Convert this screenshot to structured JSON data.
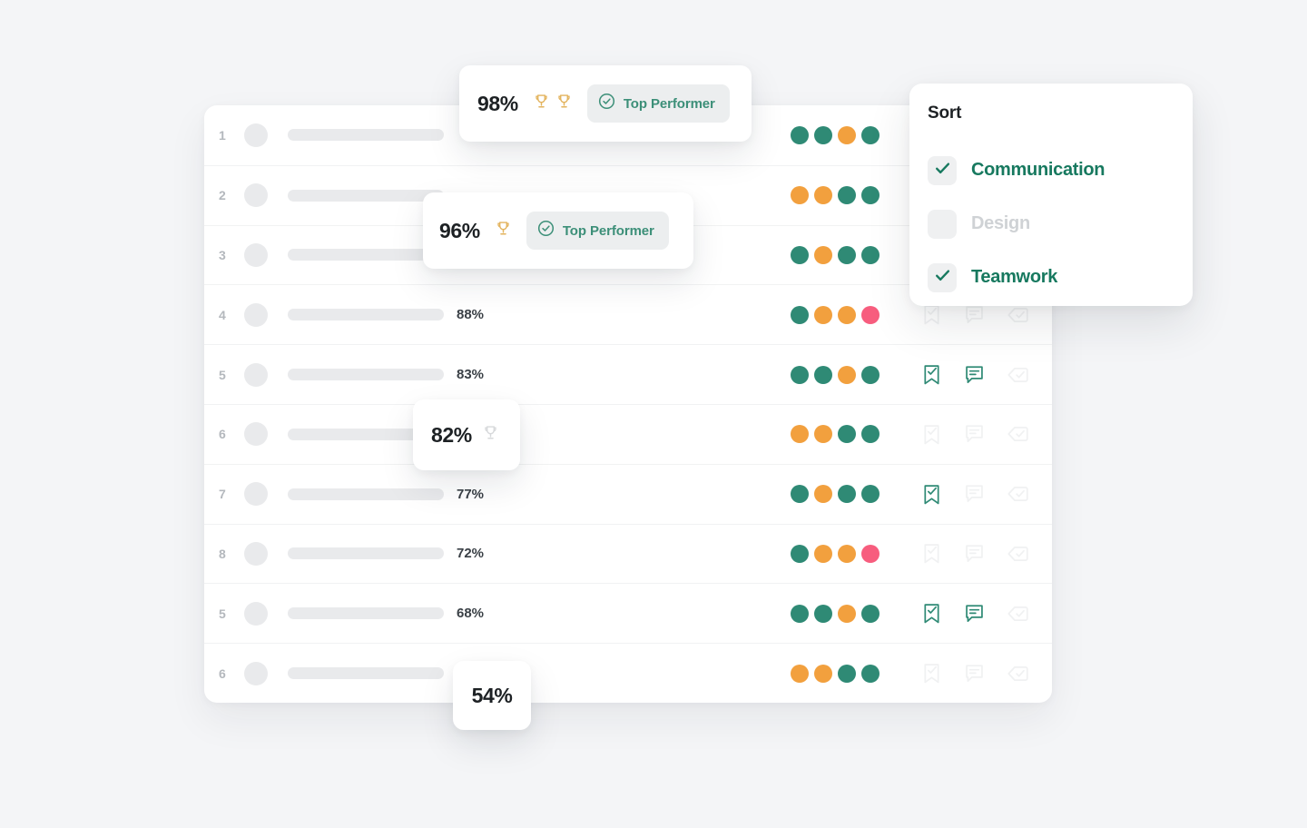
{
  "colors": {
    "teal": "#2f8a75",
    "orange": "#f2a03e",
    "pink": "#f75d7e",
    "gold": "#e3b45f",
    "badge_text": "#3c8f78",
    "sort_active": "#17795f",
    "sort_inactive": "#cfd2d5",
    "skeleton": "#e9eaec",
    "page_bg": "#f4f5f7"
  },
  "leaderboard": {
    "rows": [
      {
        "rank": "1",
        "pct": "",
        "dots": [
          "teal",
          "teal",
          "orange",
          "teal"
        ],
        "actions": [
          false,
          false,
          false
        ]
      },
      {
        "rank": "2",
        "pct": "",
        "dots": [
          "orange",
          "orange",
          "teal",
          "teal"
        ],
        "actions": [
          false,
          false,
          false
        ]
      },
      {
        "rank": "3",
        "pct": "",
        "dots": [
          "teal",
          "orange",
          "teal",
          "teal"
        ],
        "actions": [
          false,
          false,
          false
        ]
      },
      {
        "rank": "4",
        "pct": "88%",
        "dots": [
          "teal",
          "orange",
          "orange",
          "pink"
        ],
        "actions": [
          false,
          false,
          false
        ]
      },
      {
        "rank": "5",
        "pct": "83%",
        "dots": [
          "teal",
          "teal",
          "orange",
          "teal"
        ],
        "actions": [
          true,
          true,
          false
        ]
      },
      {
        "rank": "6",
        "pct": "",
        "dots": [
          "orange",
          "orange",
          "teal",
          "teal"
        ],
        "actions": [
          false,
          false,
          false
        ]
      },
      {
        "rank": "7",
        "pct": "77%",
        "dots": [
          "teal",
          "orange",
          "teal",
          "teal"
        ],
        "actions": [
          true,
          false,
          false
        ]
      },
      {
        "rank": "8",
        "pct": "72%",
        "dots": [
          "teal",
          "orange",
          "orange",
          "pink"
        ],
        "actions": [
          false,
          false,
          false
        ]
      },
      {
        "rank": "5",
        "pct": "68%",
        "dots": [
          "teal",
          "teal",
          "orange",
          "teal"
        ],
        "actions": [
          true,
          true,
          false
        ]
      },
      {
        "rank": "6",
        "pct": "",
        "dots": [
          "orange",
          "orange",
          "teal",
          "teal"
        ],
        "actions": [
          false,
          false,
          false
        ]
      }
    ]
  },
  "score_cards": [
    {
      "id": "card98",
      "score": "98%",
      "trophies": 2,
      "trophy_muted": false,
      "badge": "Top Performer"
    },
    {
      "id": "card96",
      "score": "96%",
      "trophies": 1,
      "trophy_muted": false,
      "badge": "Top Performer"
    },
    {
      "id": "card82",
      "score": "82%",
      "trophies": 1,
      "trophy_muted": true,
      "badge": ""
    },
    {
      "id": "card54",
      "score": "54%",
      "trophies": 0,
      "trophy_muted": false,
      "badge": ""
    }
  ],
  "sort_panel": {
    "title": "Sort",
    "options": [
      {
        "label": "Communication",
        "checked": true
      },
      {
        "label": "Design",
        "checked": false
      },
      {
        "label": "Teamwork",
        "checked": true
      }
    ]
  }
}
